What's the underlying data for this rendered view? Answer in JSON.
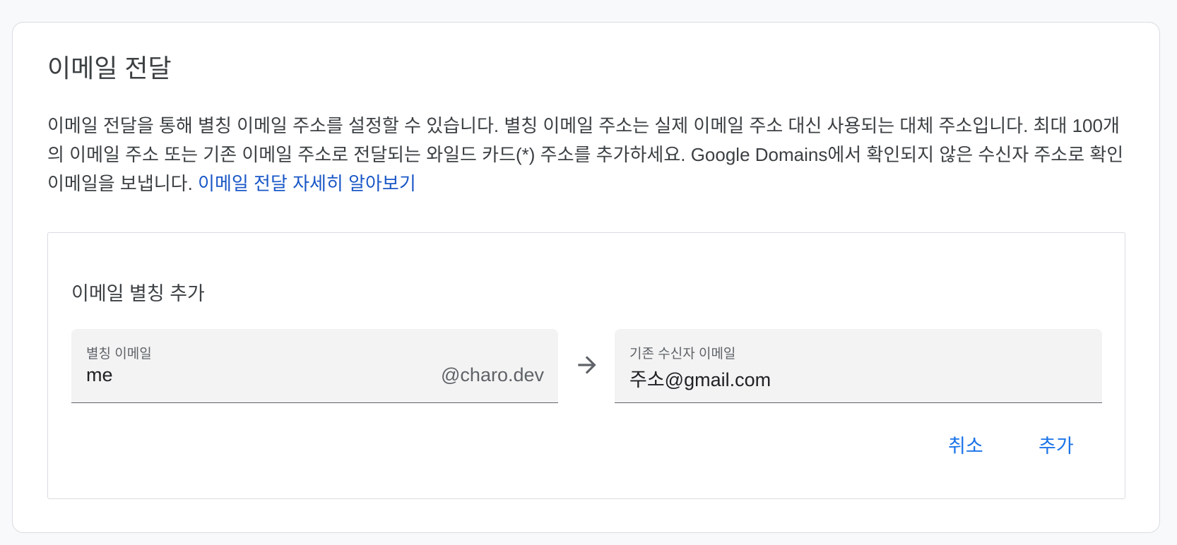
{
  "section": {
    "title": "이메일 전달",
    "description": "이메일 전달을 통해 별칭 이메일 주소를 설정할 수 있습니다. 별칭 이메일 주소는 실제 이메일 주소 대신 사용되는 대체 주소입니다. 최대 100개의 이메일 주소 또는 기존 이메일 주소로 전달되는 와일드 카드(*) 주소를 추가하세요. Google Domains에서 확인되지 않은 수신자 주소로 확인 이메일을 보냅니다.",
    "learn_more_link": "이메일 전달 자세히 알아보기"
  },
  "add_alias_form": {
    "title": "이메일 별칭 추가",
    "alias_field": {
      "label": "별칭 이메일",
      "value": "me",
      "suffix": "@charo.dev"
    },
    "arrow_icon": "arrow-right-icon",
    "destination_field": {
      "label": "기존 수신자 이메일",
      "value": "주소@gmail.com"
    },
    "cancel_label": "취소",
    "add_label": "추가"
  },
  "colors": {
    "accent": "#1a73e8",
    "link": "#1a57c7",
    "text": "#3c4043",
    "field_bg": "#f3f3f3",
    "border": "#dadce0"
  }
}
